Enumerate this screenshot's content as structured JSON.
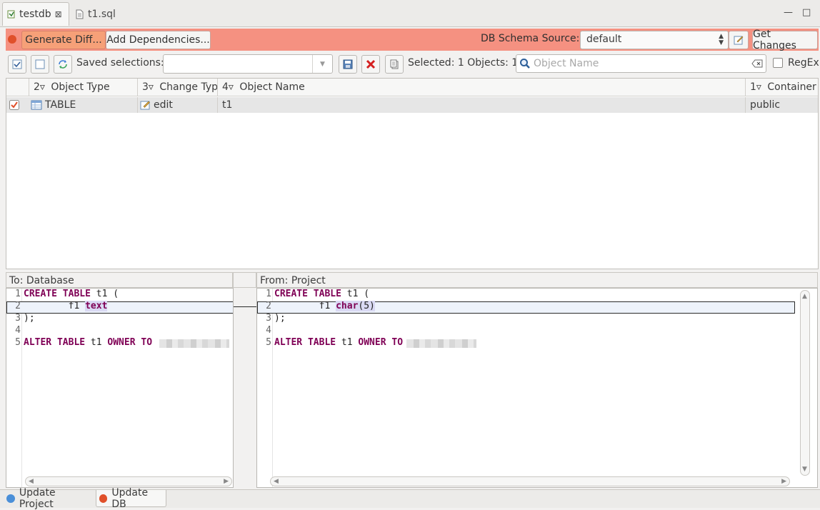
{
  "editor_tabs": [
    {
      "label": "testdb",
      "close": "⊠",
      "icon": "db-editor-icon"
    },
    {
      "label": "t1.sql",
      "icon": "file-icon"
    }
  ],
  "window_buttons": {
    "minimize": "—",
    "maximize": "□"
  },
  "red_toolbar": {
    "generate_diff": "Generate Diff...",
    "add_dependencies": "Add Dependencies...",
    "schema_source_label": "DB Schema Source:",
    "schema_source_value": "default",
    "get_changes": "Get Changes"
  },
  "filter_toolbar": {
    "saved_selections_label": "Saved selections:",
    "saved_selections_value": "",
    "selected_text": "Selected: 1",
    "objects_text": "Objects: 1",
    "search_placeholder": "Object Name",
    "regex_label": "RegEx"
  },
  "table": {
    "columns": [
      {
        "label": "Object Type",
        "sort": "2▿"
      },
      {
        "label": "Change Type",
        "sort": "3▿"
      },
      {
        "label": "Object Name",
        "sort": "4▿"
      },
      {
        "label": "Container",
        "sort": "1▿"
      }
    ],
    "rows": [
      {
        "checked": true,
        "type": "TABLE",
        "change": "edit",
        "name": "t1",
        "container": "public"
      }
    ]
  },
  "diff": {
    "left_title": "To: Database",
    "right_title": "From: Project",
    "line_numbers": [
      "1",
      "2",
      "3",
      "4",
      "5"
    ],
    "left_code": {
      "l1_kw": "CREATE TABLE",
      "l1_rest": " t1 (",
      "l2_indent": "        f1 ",
      "l2_type": "text",
      "l3": ");",
      "l5_kw1": "ALTER TABLE",
      "l5_mid": " t1 ",
      "l5_kw2": "OWNER TO"
    },
    "right_code": {
      "l1_kw": "CREATE TABLE",
      "l1_rest": " t1 (",
      "l2_indent": "        f1 ",
      "l2_type": "char",
      "l2_args": "(5)",
      "l3": ");",
      "l5_kw1": "ALTER TABLE",
      "l5_mid": " t1 ",
      "l5_kw2": "OWNER TO"
    }
  },
  "bottom_tabs": [
    {
      "label": "Update Project",
      "color": "#4a8fd8"
    },
    {
      "label": "Update DB",
      "color": "#e0502a"
    }
  ],
  "colors": {
    "toolbar_red": "#f59181",
    "generate_button": "#f6a078",
    "keyword": "#7f0055"
  }
}
